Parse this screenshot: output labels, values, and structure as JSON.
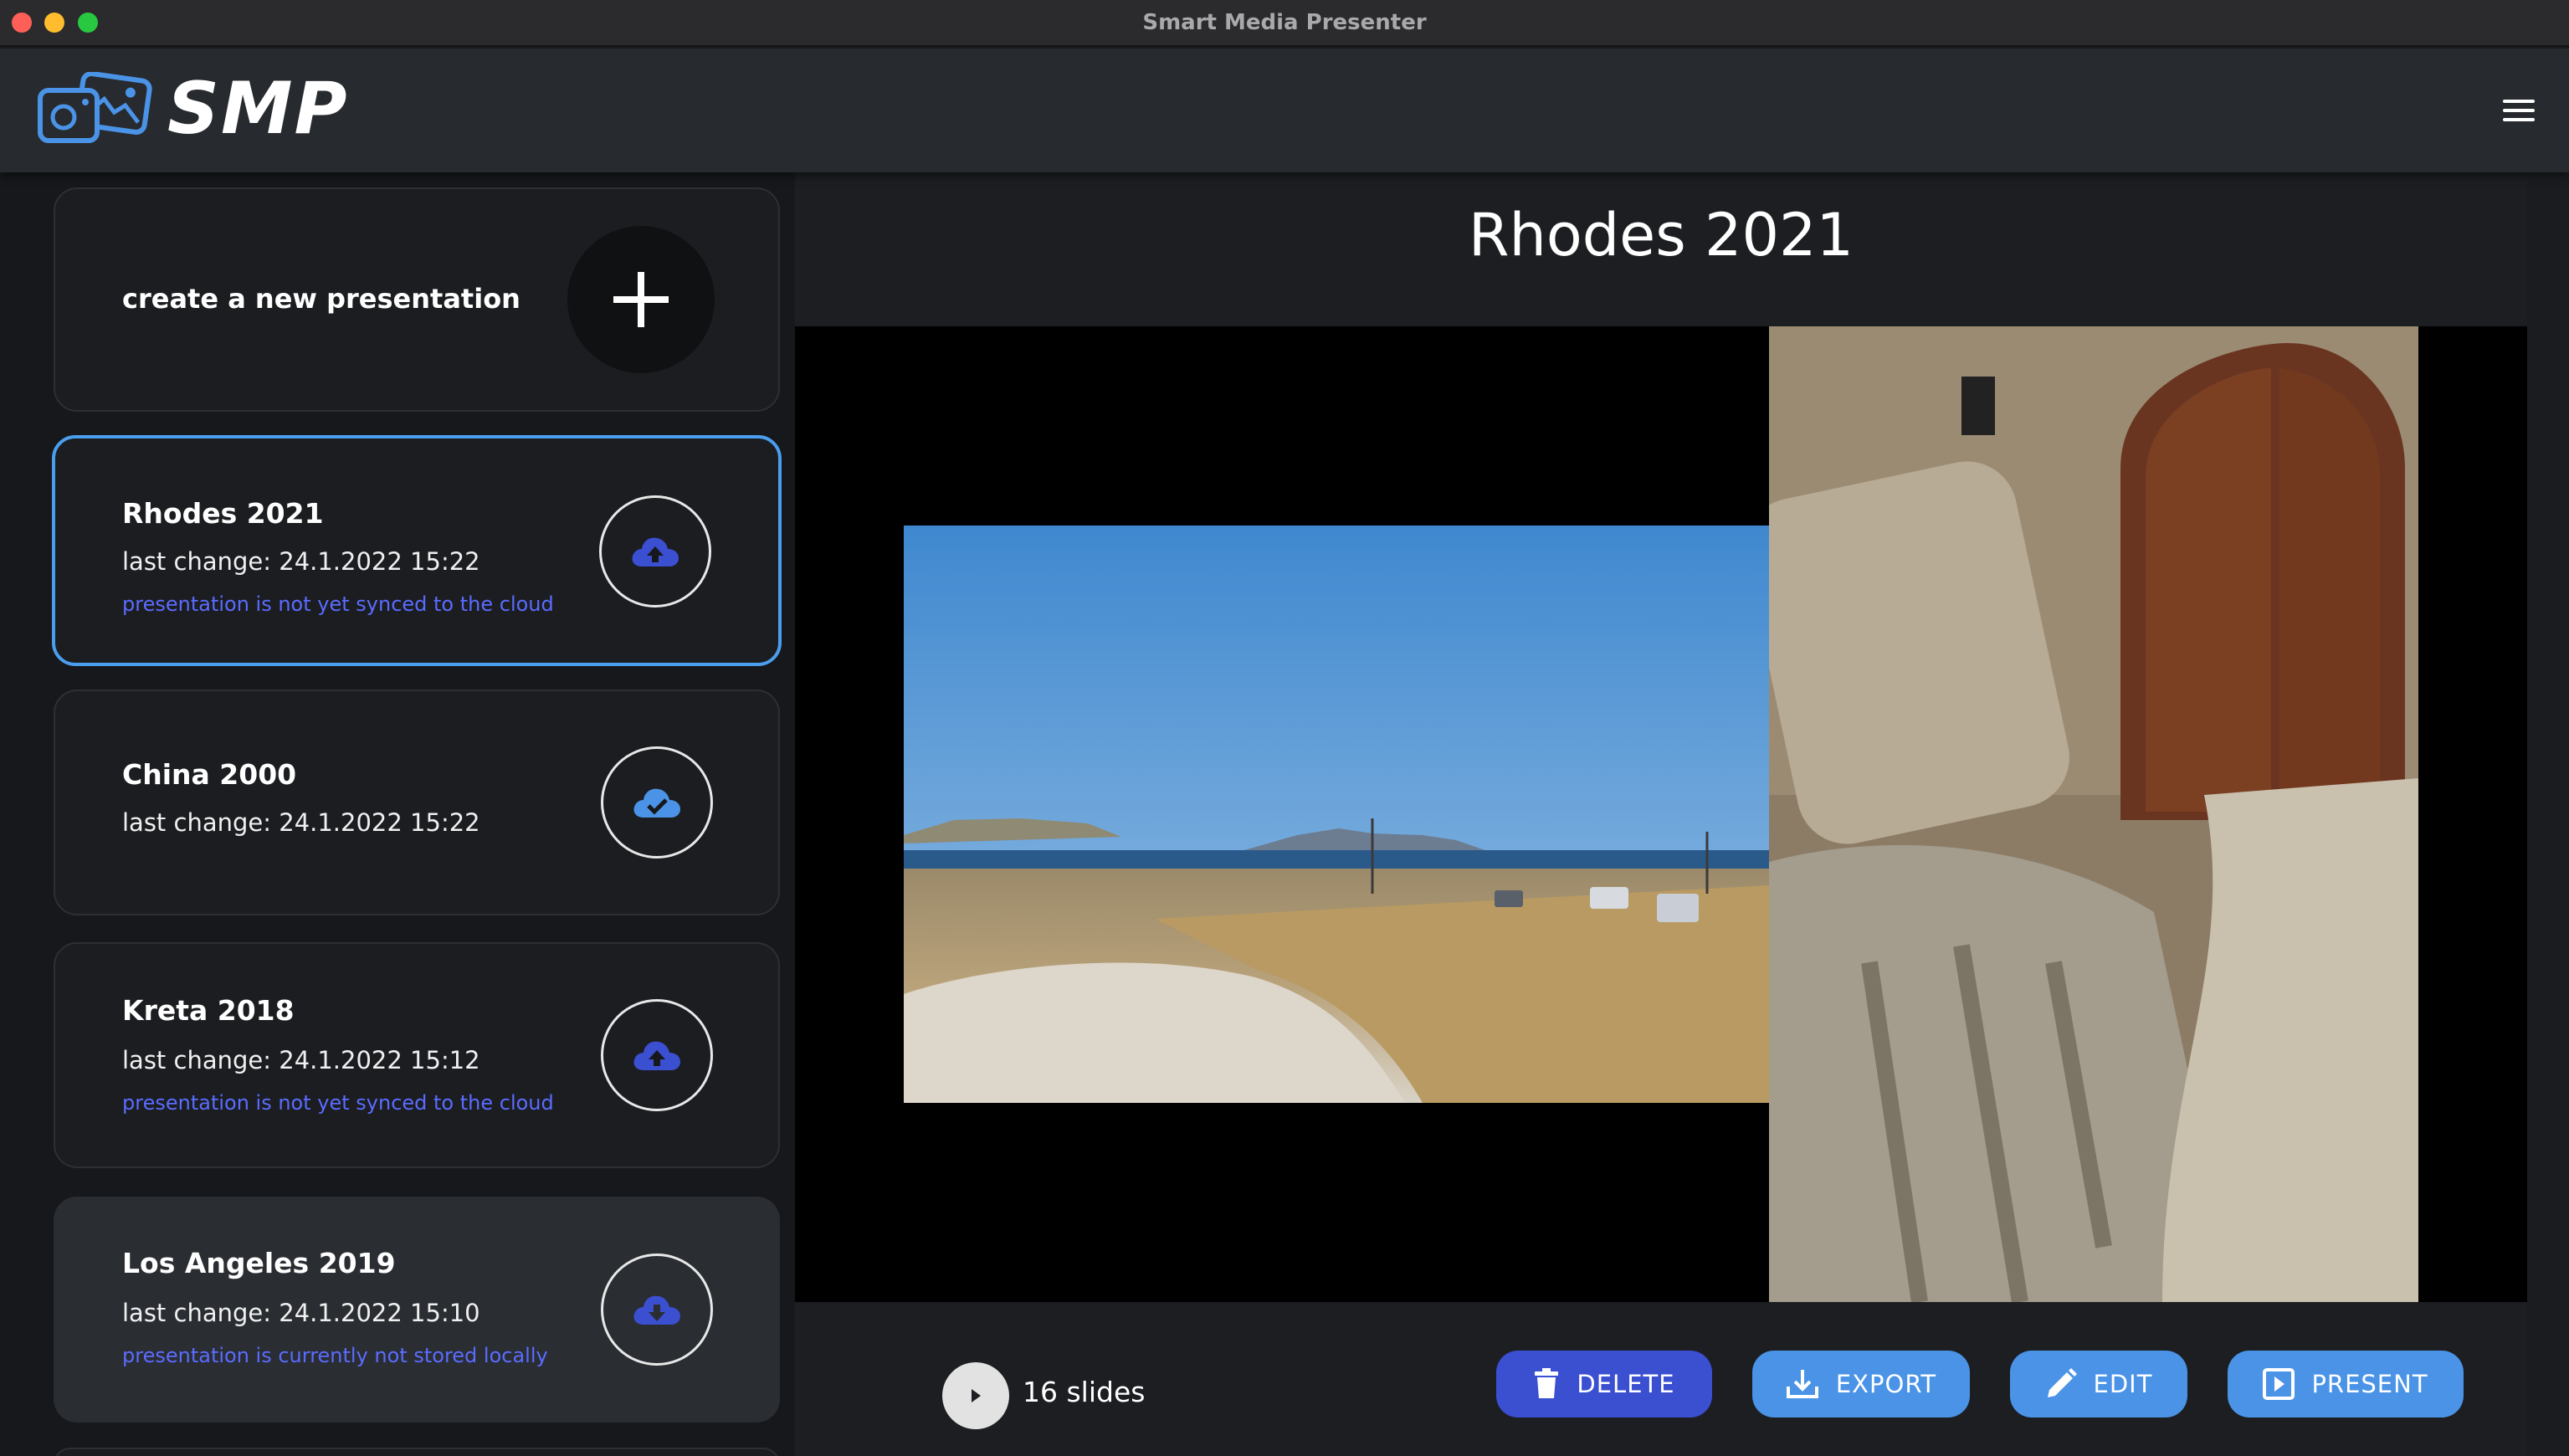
{
  "window": {
    "title": "Smart Media Presenter"
  },
  "appbar": {
    "logo_text": "SMP",
    "logo_icon": "photo-gallery-icon",
    "menu_icon": "hamburger-menu-icon"
  },
  "sidebar": {
    "new_presentation": {
      "label": "create a new presentation",
      "icon": "plus-icon"
    },
    "presentations": [
      {
        "title": "Rhodes 2021",
        "last_change": "last change: 24.1.2022 15:22",
        "status": "presentation is not yet synced to the cloud",
        "cloud_icon": "cloud-upload-icon",
        "selected": true
      },
      {
        "title": "China 2000",
        "last_change": "last change: 24.1.2022 15:22",
        "status": "",
        "cloud_icon": "cloud-check-icon",
        "selected": false
      },
      {
        "title": "Kreta 2018",
        "last_change": "last change: 24.1.2022 15:12",
        "status": "presentation is not yet synced to the cloud",
        "cloud_icon": "cloud-upload-icon",
        "selected": false
      },
      {
        "title": "Los Angeles 2019",
        "last_change": "last change: 24.1.2022 15:10",
        "status": "presentation is currently not stored locally",
        "cloud_icon": "cloud-download-icon",
        "selected": false
      }
    ]
  },
  "main": {
    "title": "Rhodes 2021",
    "slides_count": "16 slides",
    "actions": {
      "delete": "DELETE",
      "export": "EXPORT",
      "edit": "EDIT",
      "present": "PRESENT"
    }
  },
  "colors": {
    "accent_blue": "#4a93e6",
    "delete_blue": "#3b4fd1",
    "status_text": "#5a6cff",
    "selected_border": "#4a9eed"
  }
}
